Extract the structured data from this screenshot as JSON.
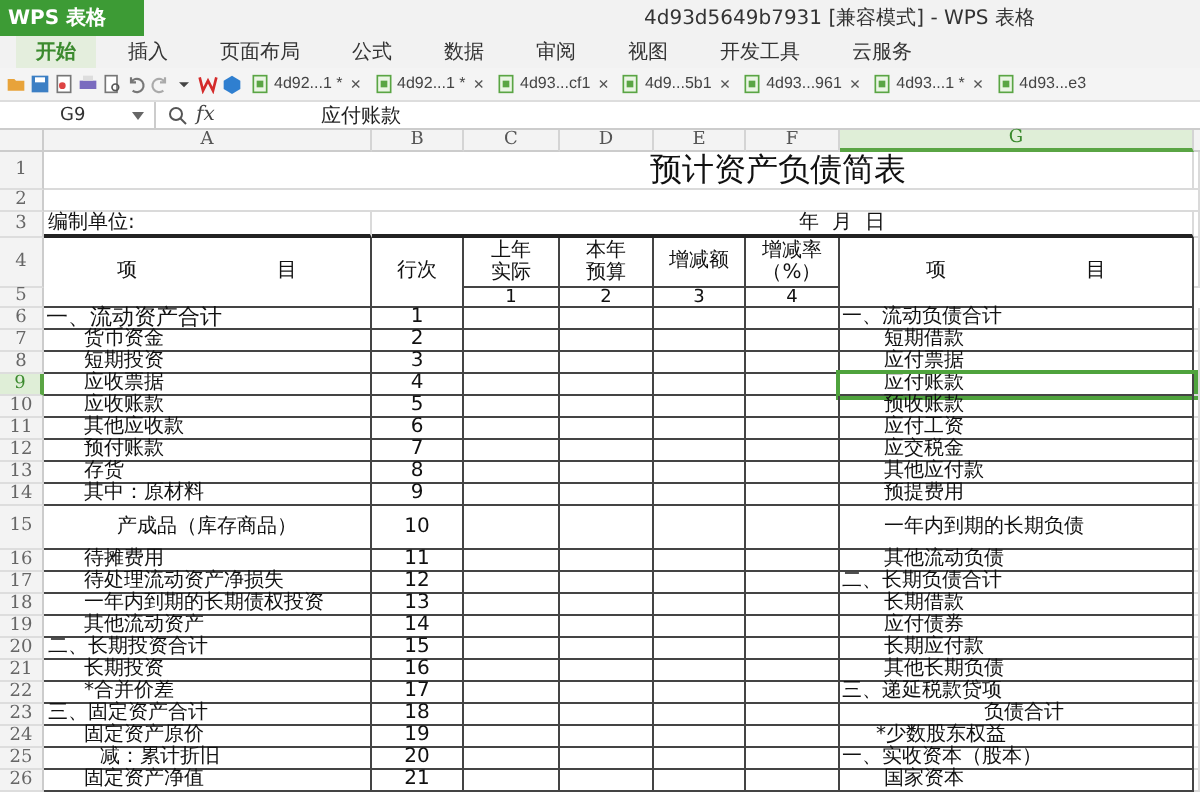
{
  "app_button": "WPS 表格",
  "window_title": "4d93d5649b7931 [兼容模式] - WPS 表格",
  "menu": [
    {
      "label": "开始",
      "selected": true
    },
    {
      "label": "插入",
      "selected": false
    },
    {
      "label": "页面布局",
      "selected": false
    },
    {
      "label": "公式",
      "selected": false
    },
    {
      "label": "数据",
      "selected": false
    },
    {
      "label": "审阅",
      "selected": false
    },
    {
      "label": "视图",
      "selected": false
    },
    {
      "label": "开发工具",
      "selected": false
    },
    {
      "label": "云服务",
      "selected": false
    }
  ],
  "documents": [
    {
      "name": "4d92...1 *",
      "close": "×"
    },
    {
      "name": "4d92...1 *",
      "close": "×"
    },
    {
      "name": "4d93...cf1",
      "close": "×"
    },
    {
      "name": "4d9...5b1",
      "close": "×"
    },
    {
      "name": "4d93...961",
      "close": "×"
    },
    {
      "name": "4d93...1 *",
      "close": "×"
    },
    {
      "name": "4d93...e3"
    }
  ],
  "name_box": "G9",
  "fx": "fx",
  "formula": "应付账款",
  "columns": [
    {
      "label": "A",
      "selected": false
    },
    {
      "label": "B",
      "selected": false
    },
    {
      "label": "C",
      "selected": false
    },
    {
      "label": "D",
      "selected": false
    },
    {
      "label": "E",
      "selected": false
    },
    {
      "label": "F",
      "selected": false
    },
    {
      "label": "G",
      "selected": true
    }
  ],
  "header_rows": [
    "1",
    "2",
    "3",
    "4",
    "5"
  ],
  "sheet": {
    "title": "预计资产负债简表",
    "unit": "编制单位:",
    "date": "年  月  日",
    "header": {
      "item_left": "项　　　　　　　目",
      "line": "行次",
      "c": "上年实际",
      "d": "本年预算",
      "e": "增减额",
      "f": "增减率（%）",
      "item_right": "项　　　　　　　目",
      "c_no": "1",
      "d_no": "2",
      "e_no": "3",
      "f_no": "4"
    },
    "rows": [
      {
        "num": "6",
        "left": {
          "text": "一、流动资产合计",
          "kind": "section"
        },
        "line": "1",
        "right": {
          "text": "一、流动负债合计",
          "kind": "section"
        },
        "selected": false
      },
      {
        "num": "7",
        "left": {
          "text": "货币资金",
          "kind": "item"
        },
        "line": "2",
        "right": {
          "text": "短期借款",
          "kind": "item"
        },
        "selected": false
      },
      {
        "num": "8",
        "left": {
          "text": "短期投资",
          "kind": "item"
        },
        "line": "3",
        "right": {
          "text": "应付票据",
          "kind": "item"
        },
        "selected": false
      },
      {
        "num": "9",
        "left": {
          "text": "应收票据",
          "kind": "item"
        },
        "line": "4",
        "right": {
          "text": "应付账款",
          "kind": "item"
        },
        "selected": true
      },
      {
        "num": "10",
        "left": {
          "text": "应收账款",
          "kind": "item"
        },
        "line": "5",
        "right": {
          "text": "预收账款",
          "kind": "item"
        },
        "selected": false
      },
      {
        "num": "11",
        "left": {
          "text": "其他应收款",
          "kind": "item"
        },
        "line": "6",
        "right": {
          "text": "应付工资",
          "kind": "item"
        },
        "selected": false
      },
      {
        "num": "12",
        "left": {
          "text": "预付账款",
          "kind": "item"
        },
        "line": "7",
        "right": {
          "text": "应交税金",
          "kind": "item"
        },
        "selected": false
      },
      {
        "num": "13",
        "left": {
          "text": "存货",
          "kind": "item"
        },
        "line": "8",
        "right": {
          "text": "其他应付款",
          "kind": "item"
        },
        "selected": false
      },
      {
        "num": "14",
        "left": {
          "text": "其中：原材料",
          "kind": "item"
        },
        "line": "9",
        "right": {
          "text": "预提费用",
          "kind": "item"
        },
        "selected": false
      },
      {
        "num": "15",
        "left": {
          "text": "产成品（库存商品）",
          "kind": "center"
        },
        "line": "10",
        "right": {
          "text": "一年内到期的长期负债",
          "kind": "item"
        },
        "selected": false
      },
      {
        "num": "16",
        "left": {
          "text": "待摊费用",
          "kind": "item"
        },
        "line": "11",
        "right": {
          "text": "其他流动负债",
          "kind": "item"
        },
        "selected": false
      },
      {
        "num": "17",
        "left": {
          "text": "待处理流动资产净损失",
          "kind": "item"
        },
        "line": "12",
        "right": {
          "text": "二、长期负债合计",
          "kind": "section"
        },
        "selected": false
      },
      {
        "num": "18",
        "left": {
          "text": "一年内到期的长期债权投资",
          "kind": "item"
        },
        "line": "13",
        "right": {
          "text": "长期借款",
          "kind": "item"
        },
        "selected": false
      },
      {
        "num": "19",
        "left": {
          "text": "其他流动资产",
          "kind": "item"
        },
        "line": "14",
        "right": {
          "text": "应付债券",
          "kind": "item"
        },
        "selected": false
      },
      {
        "num": "20",
        "left": {
          "text": "二、长期投资合计",
          "kind": "heading"
        },
        "line": "15",
        "right": {
          "text": "长期应付款",
          "kind": "item"
        },
        "selected": false
      },
      {
        "num": "21",
        "left": {
          "text": "长期投资",
          "kind": "item"
        },
        "line": "16",
        "right": {
          "text": "其他长期负债",
          "kind": "item"
        },
        "selected": false
      },
      {
        "num": "22",
        "left": {
          "text": "*合并价差",
          "kind": "item"
        },
        "line": "17",
        "right": {
          "text": "三、递延税款贷项",
          "kind": "section"
        },
        "selected": false
      },
      {
        "num": "23",
        "left": {
          "text": "三、固定资产合计",
          "kind": "heading"
        },
        "line": "18",
        "right": {
          "text": "负债合计",
          "kind": "total"
        },
        "selected": false
      },
      {
        "num": "24",
        "left": {
          "text": "固定资产原价",
          "kind": "item"
        },
        "line": "19",
        "right": {
          "text": "*少数股东权益",
          "kind": "minor"
        },
        "selected": false
      },
      {
        "num": "25",
        "left": {
          "text": "减：累计折旧",
          "kind": "sub"
        },
        "line": "20",
        "right": {
          "text": "一、实收资本（股本）",
          "kind": "section"
        },
        "selected": false
      },
      {
        "num": "26",
        "left": {
          "text": "固定资产净值",
          "kind": "item"
        },
        "line": "21",
        "right": {
          "text": "国家资本",
          "kind": "item"
        },
        "selected": false
      }
    ]
  }
}
